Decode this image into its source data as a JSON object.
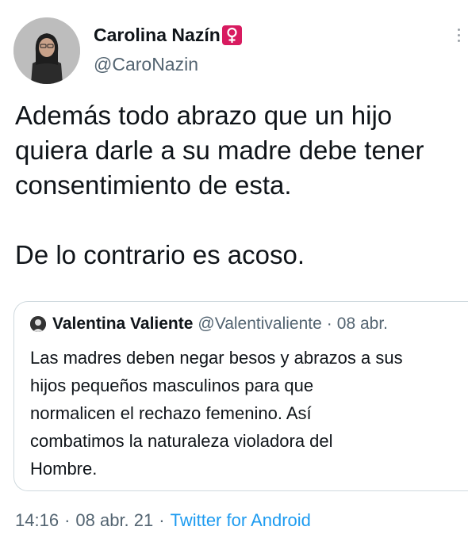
{
  "author": {
    "display_name": "Carolina Nazín",
    "handle": "@CaroNazin",
    "badge_icon": "female-sign-icon"
  },
  "tweet": {
    "lines": [
      "Además todo abrazo que un hijo",
      "quiera darle a su madre debe tener",
      "consentimiento de esta.",
      "De lo contrario es acoso."
    ]
  },
  "quote": {
    "display_name": "Valentina Valiente",
    "handle": "@Valentivaliente",
    "separator": "·",
    "date": "08 abr.",
    "lines": [
      "Las madres deben negar besos y abrazos a sus",
      "hijos pequeños masculinos para que",
      "normalicen el rechazo femenino. Así",
      "combatimos la naturaleza violadora del",
      "Hombre."
    ]
  },
  "meta": {
    "time": "14:16",
    "separator": "·",
    "date": "08 abr. 21",
    "source": "Twitter for Android"
  },
  "colors": {
    "text": "#0f1419",
    "secondary": "#536471",
    "link": "#1d9bf0",
    "badge": "#d81b60",
    "border": "#cfd9de"
  }
}
